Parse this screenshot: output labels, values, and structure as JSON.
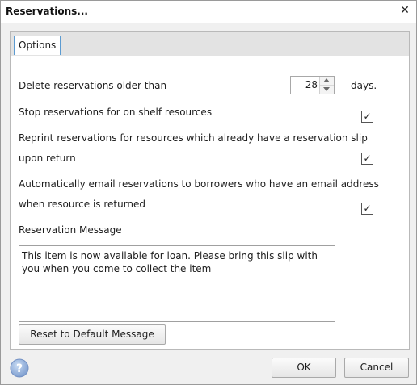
{
  "window": {
    "title": "Reservations...",
    "close_glyph": "✕"
  },
  "tabs": [
    {
      "label": "Options",
      "selected": true
    }
  ],
  "options": {
    "delete_label": "Delete reservations older than",
    "delete_days_value": "28",
    "delete_days_unit": "days.",
    "stop_label": "Stop reservations for on shelf resources",
    "stop_checked": true,
    "reprint_label_line1": "Reprint reservations for resources which already have a reservation slip",
    "reprint_label_line2": "upon return",
    "reprint_checked": true,
    "email_label_line1": "Automatically email reservations to borrowers who have an email address",
    "email_label_line2": "when resource is returned",
    "email_checked": true,
    "message_label": "Reservation Message",
    "message_value": "This item is now available for loan. Please bring this slip with you when you come to collect the item",
    "check_glyph": "✓"
  },
  "buttons": {
    "reset": "Reset to Default Message",
    "ok": "OK",
    "cancel": "Cancel"
  },
  "icons": {
    "help": "help-icon"
  },
  "colors": {
    "accent_tab_border": "#5c9bd1",
    "help_icon": "#8fb0dc"
  }
}
